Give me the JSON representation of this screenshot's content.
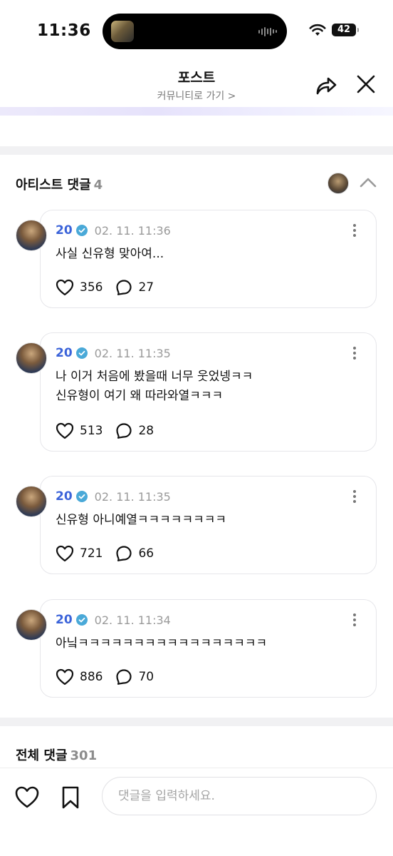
{
  "status_bar": {
    "time": "11:36",
    "battery": "42"
  },
  "header": {
    "title": "포스트",
    "subtitle": "커뮤니티로 가기 >"
  },
  "artist_comments": {
    "title": "아티스트 댓글",
    "count": "4",
    "items": [
      {
        "author": "20",
        "time": "02. 11. 11:36",
        "text": "사실 신유형 맞아여...",
        "likes": "356",
        "replies": "27"
      },
      {
        "author": "20",
        "time": "02. 11. 11:35",
        "text": "나 이거 처음에 봤을때 너무 웃었넹ㅋㅋ\n신유형이 여기 왜 따라와열ㅋㅋㅋ",
        "likes": "513",
        "replies": "28"
      },
      {
        "author": "20",
        "time": "02. 11. 11:35",
        "text": "신유형 아니예열ㅋㅋㅋㅋㅋㅋㅋㅋ",
        "likes": "721",
        "replies": "66"
      },
      {
        "author": "20",
        "time": "02. 11. 11:34",
        "text": "아닠ㅋㅋㅋㅋㅋㅋㅋㅋㅋㅋㅋㅋㅋㅋㅋㅋㅋ",
        "likes": "886",
        "replies": "70"
      }
    ]
  },
  "all_comments": {
    "title": "전체 댓글",
    "count": "301"
  },
  "bottom_bar": {
    "input_placeholder": "댓글을 입력하세요."
  },
  "colors": {
    "author": "#3b63d9",
    "verified": "#4aa9d8",
    "muted": "#8c8c8c"
  },
  "icons": {
    "share": "share-arrow-icon",
    "close": "close-icon",
    "collapse": "chevron-up-icon",
    "verified": "verified-badge-icon",
    "more": "more-vertical-icon",
    "like": "heart-icon",
    "reply": "speech-bubble-icon",
    "bookmark": "bookmark-icon"
  }
}
